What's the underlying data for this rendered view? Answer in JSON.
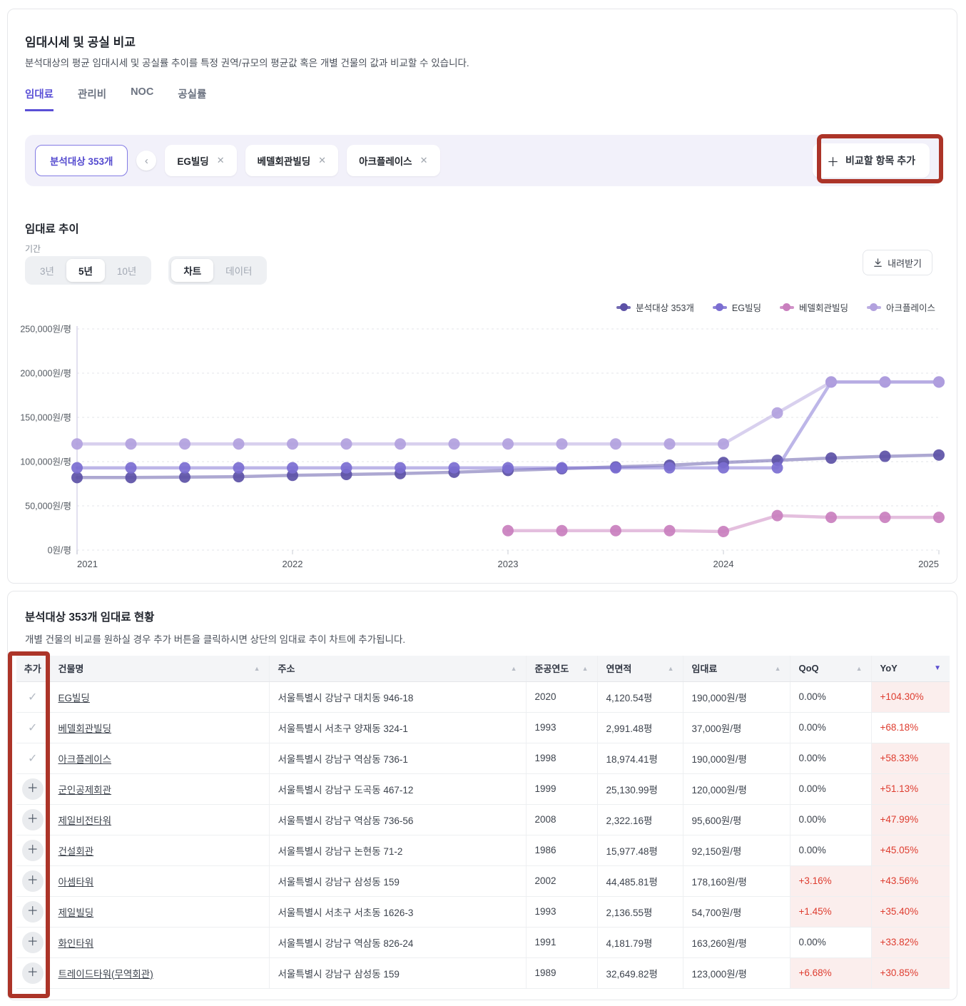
{
  "header": {
    "title": "임대시세 및 공실 비교",
    "description": "분석대상의 평균 임대시세 및 공실률 추이를 특정 권역/규모의 평균값 혹은 개별 건물의 값과 비교할 수 있습니다.",
    "tabs": [
      {
        "label": "임대료",
        "active": true
      },
      {
        "label": "관리비",
        "active": false
      },
      {
        "label": "NOC",
        "active": false
      },
      {
        "label": "공실률",
        "active": false
      }
    ]
  },
  "filter": {
    "target_button": "분석대상 353개",
    "collapse_icon": "‹",
    "chips": [
      "EG빌딩",
      "베델회관빌딩",
      "아크플레이스"
    ],
    "remove_icon": "✕",
    "add_button_label": "비교할 항목 추가"
  },
  "chart_section": {
    "title": "임대료 추이",
    "period_label": "기간",
    "period_options": [
      "3년",
      "5년",
      "10년"
    ],
    "period_selected": "5년",
    "view_options": [
      "차트",
      "데이터"
    ],
    "view_selected": "차트",
    "download_label": "내려받기"
  },
  "chart_data": {
    "type": "line",
    "unit": "원/평",
    "x_mode": "quarterly",
    "x_range": [
      "2021Q1",
      "2025Q1"
    ],
    "x_tick_labels": [
      "2021",
      "2022",
      "2023",
      "2024",
      "2025"
    ],
    "ylim": [
      0,
      250000
    ],
    "y_ticks": [
      0,
      50000,
      100000,
      150000,
      200000,
      250000
    ],
    "y_tick_labels": [
      "0원/평",
      "50,000원/평",
      "100,000원/평",
      "150,000원/평",
      "200,000원/평",
      "250,000원/평"
    ],
    "grid": "horizontal-dashed",
    "legend_position": "top-right",
    "series": [
      {
        "name": "분석대상 353개",
        "color": "#5C51A6",
        "values": [
          82000,
          82000,
          82500,
          83000,
          84500,
          85500,
          86500,
          88000,
          90000,
          92000,
          94000,
          96000,
          99000,
          101500,
          104000,
          106000,
          107500
        ]
      },
      {
        "name": "EG빌딩",
        "color": "#7B6ED1",
        "values": [
          93000,
          93000,
          93000,
          93000,
          93000,
          93000,
          93000,
          93000,
          93000,
          93000,
          93000,
          93000,
          93000,
          93000,
          190000,
          190000,
          190000
        ]
      },
      {
        "name": "베델회관빌딩",
        "color": "#C97FBE",
        "values": [
          null,
          null,
          null,
          null,
          null,
          null,
          null,
          null,
          22000,
          22000,
          22000,
          22000,
          21000,
          39000,
          37000,
          37000,
          37000
        ]
      },
      {
        "name": "아크플레이스",
        "color": "#B2A1DE",
        "values": [
          120000,
          120000,
          120000,
          120000,
          120000,
          120000,
          120000,
          120000,
          120000,
          120000,
          120000,
          120000,
          120000,
          155000,
          190000,
          190000,
          190000
        ]
      }
    ]
  },
  "table_section": {
    "title": "분석대상 353개 임대료 현황",
    "description": "개별 건물의 비교를 원하실 경우 추가 버튼을 클릭하시면 상단의 임대료 추이 차트에 추가됩니다.",
    "columns": [
      "추가",
      "건물명",
      "주소",
      "준공연도",
      "연면적",
      "임대료",
      "QoQ",
      "YoY"
    ],
    "sort_column": "YoY",
    "sort_direction": "desc",
    "added_icon": "✓",
    "add_icon": "＋",
    "rows": [
      {
        "added": true,
        "name": "EG빌딩",
        "address": "서울특별시 강남구 대치동 946-18",
        "year": "2020",
        "area": "4,120.54평",
        "rent": "190,000원/평",
        "qoq": "0.00%",
        "qoq_hot": false,
        "yoy": "+104.30%",
        "yoy_hot": true
      },
      {
        "added": true,
        "name": "베델회관빌딩",
        "address": "서울특별시 서초구 양재동 324-1",
        "year": "1993",
        "area": "2,991.48평",
        "rent": "37,000원/평",
        "qoq": "0.00%",
        "qoq_hot": false,
        "yoy": "+68.18%",
        "yoy_hot": false
      },
      {
        "added": true,
        "name": "아크플레이스",
        "address": "서울특별시 강남구 역삼동 736-1",
        "year": "1998",
        "area": "18,974.41평",
        "rent": "190,000원/평",
        "qoq": "0.00%",
        "qoq_hot": false,
        "yoy": "+58.33%",
        "yoy_hot": true
      },
      {
        "added": false,
        "name": "군인공제회관",
        "address": "서울특별시 강남구 도곡동 467-12",
        "year": "1999",
        "area": "25,130.99평",
        "rent": "120,000원/평",
        "qoq": "0.00%",
        "qoq_hot": false,
        "yoy": "+51.13%",
        "yoy_hot": true
      },
      {
        "added": false,
        "name": "제일비전타워",
        "address": "서울특별시 강남구 역삼동 736-56",
        "year": "2008",
        "area": "2,322.16평",
        "rent": "95,600원/평",
        "qoq": "0.00%",
        "qoq_hot": false,
        "yoy": "+47.99%",
        "yoy_hot": true
      },
      {
        "added": false,
        "name": "건설회관",
        "address": "서울특별시 강남구 논현동 71-2",
        "year": "1986",
        "area": "15,977.48평",
        "rent": "92,150원/평",
        "qoq": "0.00%",
        "qoq_hot": false,
        "yoy": "+45.05%",
        "yoy_hot": true
      },
      {
        "added": false,
        "name": "아셈타워",
        "address": "서울특별시 강남구 삼성동 159",
        "year": "2002",
        "area": "44,485.81평",
        "rent": "178,160원/평",
        "qoq": "+3.16%",
        "qoq_hot": true,
        "yoy": "+43.56%",
        "yoy_hot": true
      },
      {
        "added": false,
        "name": "제일빌딩",
        "address": "서울특별시 서초구 서초동 1626-3",
        "year": "1993",
        "area": "2,136.55평",
        "rent": "54,700원/평",
        "qoq": "+1.45%",
        "qoq_hot": true,
        "yoy": "+35.40%",
        "yoy_hot": true
      },
      {
        "added": false,
        "name": "화인타워",
        "address": "서울특별시 강남구 역삼동 826-24",
        "year": "1991",
        "area": "4,181.79평",
        "rent": "163,260원/평",
        "qoq": "0.00%",
        "qoq_hot": false,
        "yoy": "+33.82%",
        "yoy_hot": true
      },
      {
        "added": false,
        "name": "트레이드타워(무역회관)",
        "address": "서울특별시 강남구 삼성동 159",
        "year": "1989",
        "area": "32,649.82평",
        "rent": "123,000원/평",
        "qoq": "+6.68%",
        "qoq_hot": true,
        "yoy": "+30.85%",
        "yoy_hot": true
      }
    ]
  },
  "annotations": {
    "highlight_color": "#AC3428",
    "targets": [
      "add-compare-button",
      "table-add-column"
    ]
  }
}
